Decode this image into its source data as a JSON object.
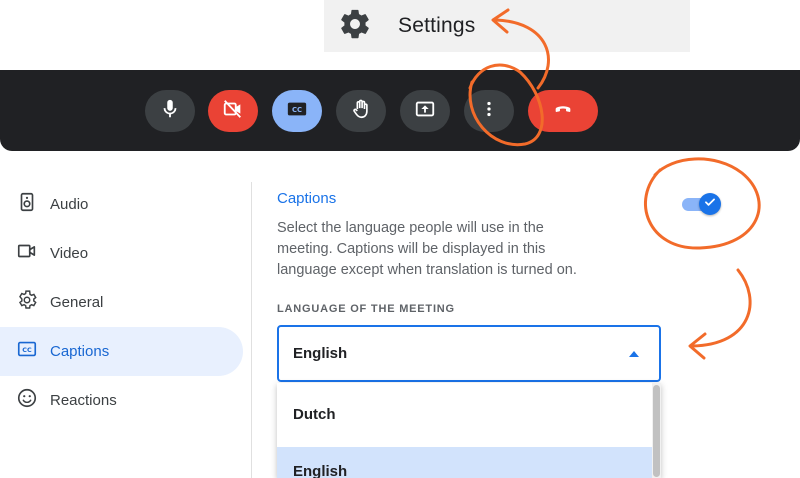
{
  "settings_menu": {
    "label": "Settings",
    "icon": "gear-icon"
  },
  "controls": [
    {
      "name": "mic-button",
      "icon": "microphone-icon"
    },
    {
      "name": "camera-off-button",
      "icon": "camera-off-icon"
    },
    {
      "name": "captions-button",
      "icon": "cc-icon"
    },
    {
      "name": "raise-hand-button",
      "icon": "hand-icon"
    },
    {
      "name": "present-button",
      "icon": "present-icon"
    },
    {
      "name": "more-options-button",
      "icon": "more-vert-icon"
    },
    {
      "name": "end-call-button",
      "icon": "phone-hangup-icon"
    }
  ],
  "sidebar": {
    "items": [
      {
        "label": "Audio",
        "icon": "speaker-icon"
      },
      {
        "label": "Video",
        "icon": "videocam-icon"
      },
      {
        "label": "General",
        "icon": "gear-icon"
      },
      {
        "label": "Captions",
        "icon": "cc-icon",
        "active": true
      },
      {
        "label": "Reactions",
        "icon": "smiley-icon"
      }
    ]
  },
  "captions": {
    "title": "Captions",
    "description": "Select the language people will use in the meeting. Captions will be displayed in this language except when translation is turned on.",
    "toggle_on": true,
    "language_label": "LANGUAGE OF THE MEETING",
    "selected_language": "English",
    "options": [
      "Dutch",
      "English"
    ]
  },
  "colors": {
    "accent": "#1a73e8",
    "bar": "#202124",
    "red": "#ea4335",
    "annotation": "#f26b2a"
  }
}
